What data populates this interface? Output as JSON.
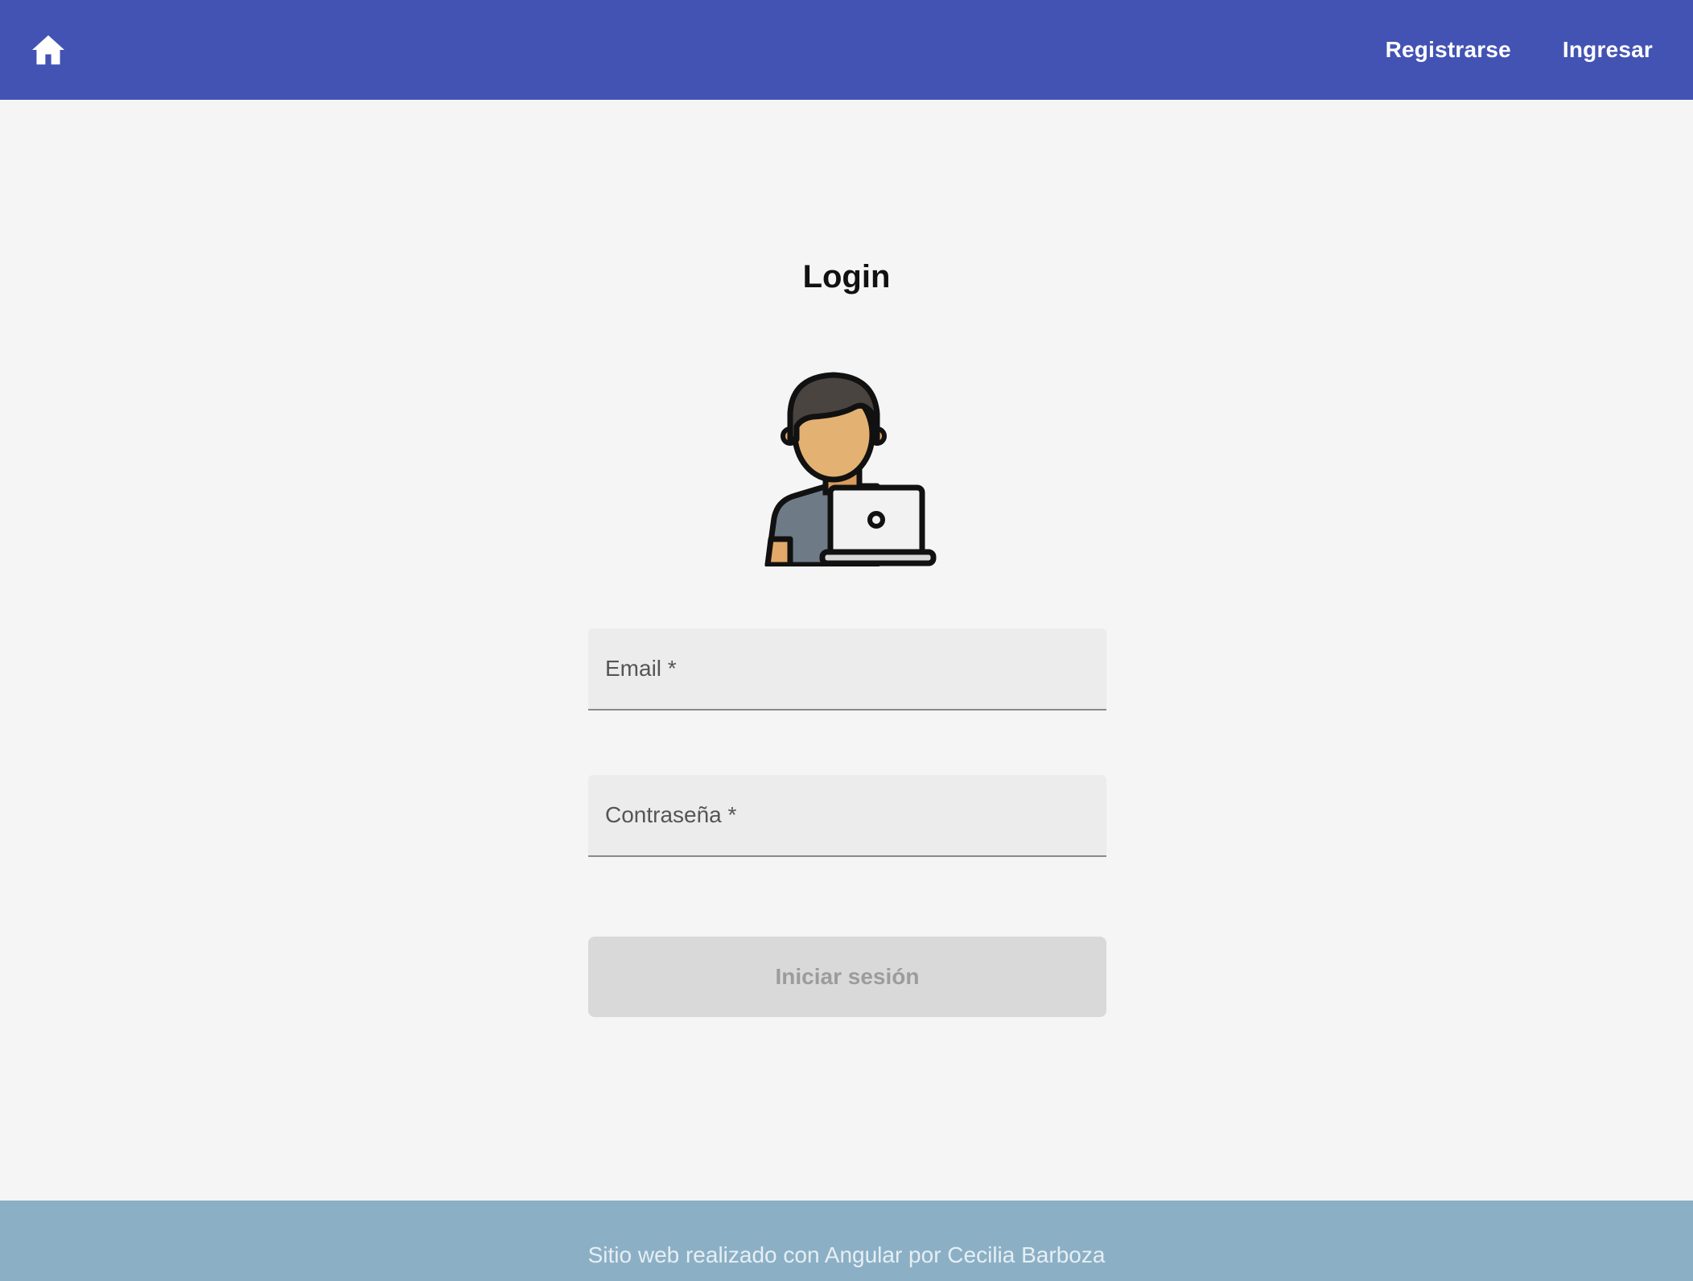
{
  "header": {
    "home_icon": "home-icon",
    "nav": {
      "register_label": "Registrarse",
      "login_label": "Ingresar"
    },
    "color": "#4353b4"
  },
  "main": {
    "title": "Login",
    "avatar_icon": "user-laptop-icon",
    "email_field": {
      "label": "Email *",
      "value": ""
    },
    "password_field": {
      "label": "Contraseña *",
      "value": ""
    },
    "submit_label": "Iniciar sesión"
  },
  "footer": {
    "text": "Sitio web realizado con Angular por Cecilia Barboza",
    "color": "#8bb0c6"
  }
}
